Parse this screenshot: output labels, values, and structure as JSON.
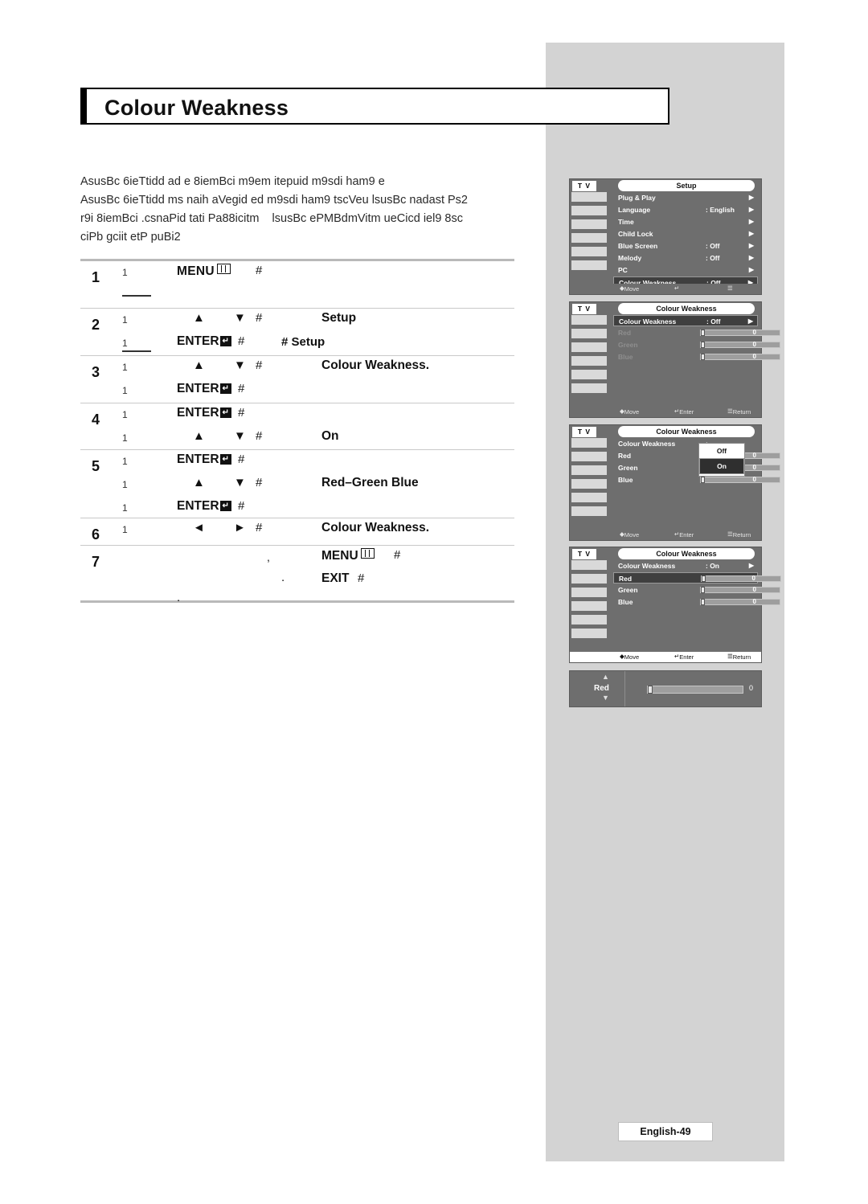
{
  "page": {
    "title": "Colour Weakness",
    "footer_tag": "English-49"
  },
  "intro": {
    "line1": "AsusBc 6ieTtidd ad e 8iemBci m9em itepuid m9sdi ham9 e",
    "line2": "AsusBc 6ieTtidd ms naih aVegid ed m9sdi ham9 tscVeu lsusBc nadast Ps2",
    "line3": "r9i 8iemBci .csnaPid tati Pa88icitm    lsusBc ePMBdmVitm ueCicd iel9 8sc",
    "line4": "ciPb gciit etP puBi2"
  },
  "steps": [
    {
      "num": "1",
      "lines": [
        {
          "one": "1",
          "key": "MENU",
          "glyph": "menu",
          "hash": "#",
          "label": ""
        }
      ]
    },
    {
      "num": "2",
      "lines": [
        {
          "one": "1",
          "arrows": "▲ ▼",
          "hash": "#",
          "label": "Setup"
        },
        {
          "one": "1",
          "key": "ENTER",
          "glyph": "enter",
          "hash": "#",
          "label": ""
        }
      ]
    },
    {
      "num": "3",
      "dot_label": "# Setup",
      "lines": [
        {
          "one": "1",
          "arrows": "▲ ▼",
          "hash": "#",
          "label": "Colour Weakness."
        },
        {
          "one": "1",
          "key": "ENTER",
          "glyph": "enter",
          "hash": "#",
          "label": ""
        }
      ]
    },
    {
      "num": "4",
      "lines": [
        {
          "one": "1",
          "key": "ENTER",
          "glyph": "enter",
          "hash": "#",
          "label": ""
        },
        {
          "one": "1",
          "arrows": "▲ ▼",
          "hash": "#",
          "label": "On"
        }
      ]
    },
    {
      "num": "5",
      "lines": [
        {
          "one": "1",
          "key": "ENTER",
          "glyph": "enter",
          "hash": "#",
          "label": ""
        },
        {
          "one": "1",
          "arrows": "▲ ▼",
          "hash": "#",
          "label": "Red–Green    Blue"
        },
        {
          "one": "1",
          "key": "ENTER",
          "glyph": "enter",
          "hash": "#",
          "label": ""
        }
      ]
    },
    {
      "num": "6",
      "lines": [
        {
          "one": "1",
          "arrows": "◄ ►",
          "hash": "#",
          "label": "Colour Weakness."
        }
      ]
    },
    {
      "num": "7",
      "lines": [
        {
          "one": "",
          "comma": ",",
          "key": "MENU",
          "glyph": "menu",
          "hash": "#",
          "label": ""
        },
        {
          "one": "",
          "dot": ".",
          "key": "EXIT",
          "glyph": "none",
          "hash": "#",
          "label": ""
        }
      ]
    }
  ],
  "osd": {
    "tv_label": "T V",
    "foot": {
      "move": "Move",
      "enter": "Enter",
      "return": "Return"
    },
    "screens": [
      {
        "name": "setup-menu",
        "title": "Setup",
        "items": [
          {
            "label": "Plug & Play",
            "value": "",
            "arrow": "▶",
            "selected": false
          },
          {
            "label": "Language",
            "value": ": English",
            "arrow": "▶",
            "selected": false
          },
          {
            "label": "Time",
            "value": "",
            "arrow": "▶",
            "selected": false
          },
          {
            "label": "Child Lock",
            "value": "",
            "arrow": "▶",
            "selected": false
          },
          {
            "label": "Blue Screen",
            "value": ": Off",
            "arrow": "▶",
            "selected": false
          },
          {
            "label": "Melody",
            "value": ": Off",
            "arrow": "▶",
            "selected": false
          },
          {
            "label": "PC",
            "value": "",
            "arrow": "▶",
            "selected": false
          },
          {
            "label": "Colour Weakness",
            "value": ": Off",
            "arrow": "▶",
            "selected": true
          }
        ]
      },
      {
        "name": "colour-weakness-off",
        "title": "Colour Weakness",
        "items": [
          {
            "label": "Colour Weakness",
            "value": ": Off",
            "arrow": "▶",
            "selected": true
          },
          {
            "label": "Red",
            "slider": true,
            "num": "0",
            "knob": 0,
            "dim": true
          },
          {
            "label": "Green",
            "slider": true,
            "num": "0",
            "knob": 0,
            "dim": true
          },
          {
            "label": "Blue",
            "slider": true,
            "num": "0",
            "knob": 0,
            "dim": true
          }
        ]
      },
      {
        "name": "colour-weakness-on-popup",
        "title": "Colour Weakness",
        "items": [
          {
            "label": "Colour Weakness",
            "value": ":",
            "arrow": "",
            "selected": false
          },
          {
            "label": "Red",
            "slider": true,
            "num": "0",
            "knob": 0
          },
          {
            "label": "Green",
            "slider": true,
            "num": "0",
            "knob": 0
          },
          {
            "label": "Blue",
            "slider": true,
            "num": "0",
            "knob": 0
          }
        ],
        "popup": {
          "off": "Off",
          "on": "On"
        }
      },
      {
        "name": "colour-weakness-on",
        "title": "Colour Weakness",
        "items": [
          {
            "label": "Colour Weakness",
            "value": ": On",
            "arrow": "▶",
            "selected": false
          },
          {
            "label": "Red",
            "slider": true,
            "num": "0",
            "knob": 0,
            "selected": true
          },
          {
            "label": "Green",
            "slider": true,
            "num": "0",
            "knob": 0
          },
          {
            "label": "Blue",
            "slider": true,
            "num": "0",
            "knob": 0
          }
        ]
      }
    ],
    "adjust": {
      "label": "Red",
      "num": "0",
      "up": "▲",
      "down": "▼"
    }
  }
}
